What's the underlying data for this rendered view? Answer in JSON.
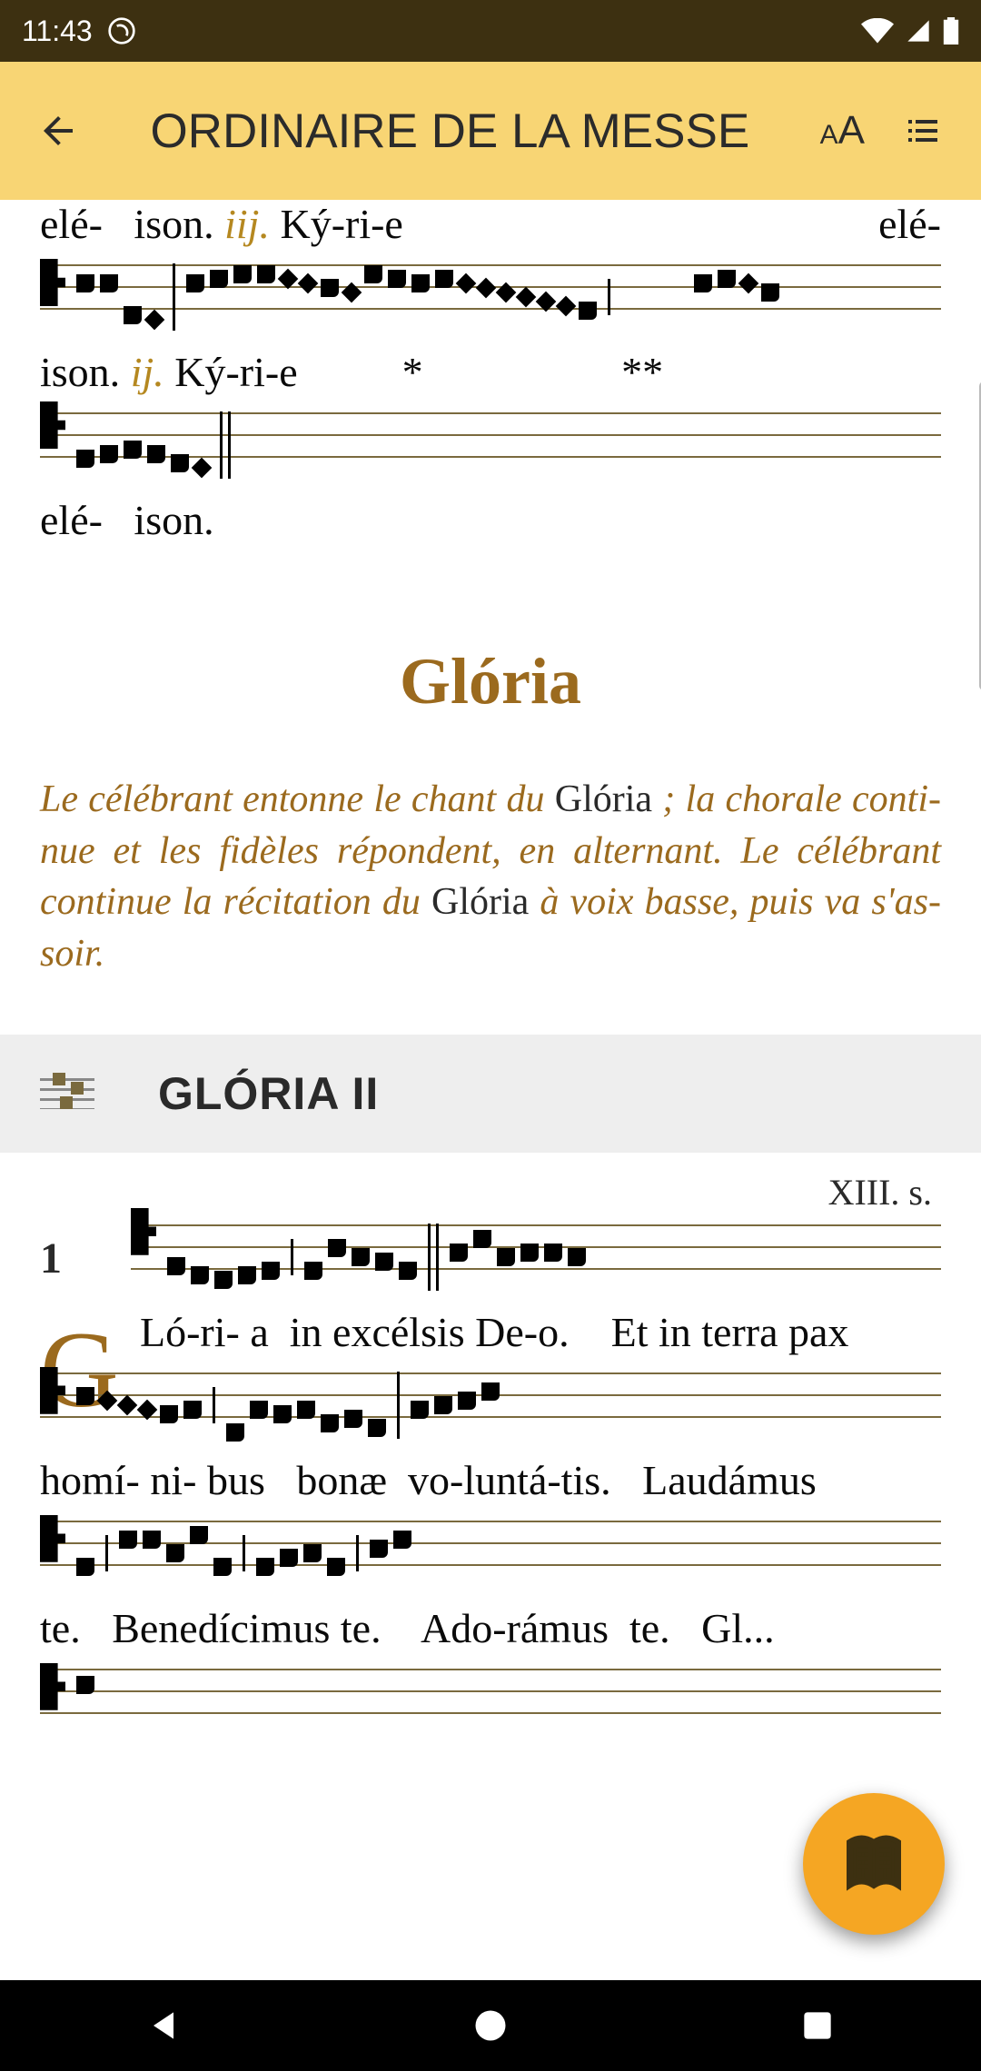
{
  "status": {
    "time": "11:43"
  },
  "header": {
    "title": "ORDINAIRE DE LA MESSE"
  },
  "kyrie": {
    "line1_a": "elé-   ison.",
    "line1_rubric": "iij.",
    "line1_b": " Ký-ri-e",
    "line1_c": "elé-",
    "line2_a": "ison. ",
    "line2_rubric": "ij.",
    "line2_b": " Ký-ri-e          *                   **",
    "line3": "elé-   ison."
  },
  "gloria": {
    "title": "Glória",
    "rubric_1": "Le célébrant entonne le chant du ",
    "rubric_g1": "Glória",
    "rubric_2": " ; la chorale conti­nue et les fidèles répondent, en alternant. Le célébrant continue la récitation du ",
    "rubric_g2": "Glória",
    "rubric_3": " à voix basse, puis va s'as­soir.",
    "header_label": "GLÓRIA II",
    "century": "XIII. s.",
    "mode": "1",
    "dropcap": "G",
    "lyr1": "Ló-ri- a  in excélsis De-o.    Et in terra pax",
    "lyr2": "homí- ni- bus   bonæ  vo-luntá-tis.   Laudámus",
    "lyr3": "te.   Benedícimus te.    Ado-rámus  te.   Gl..."
  }
}
